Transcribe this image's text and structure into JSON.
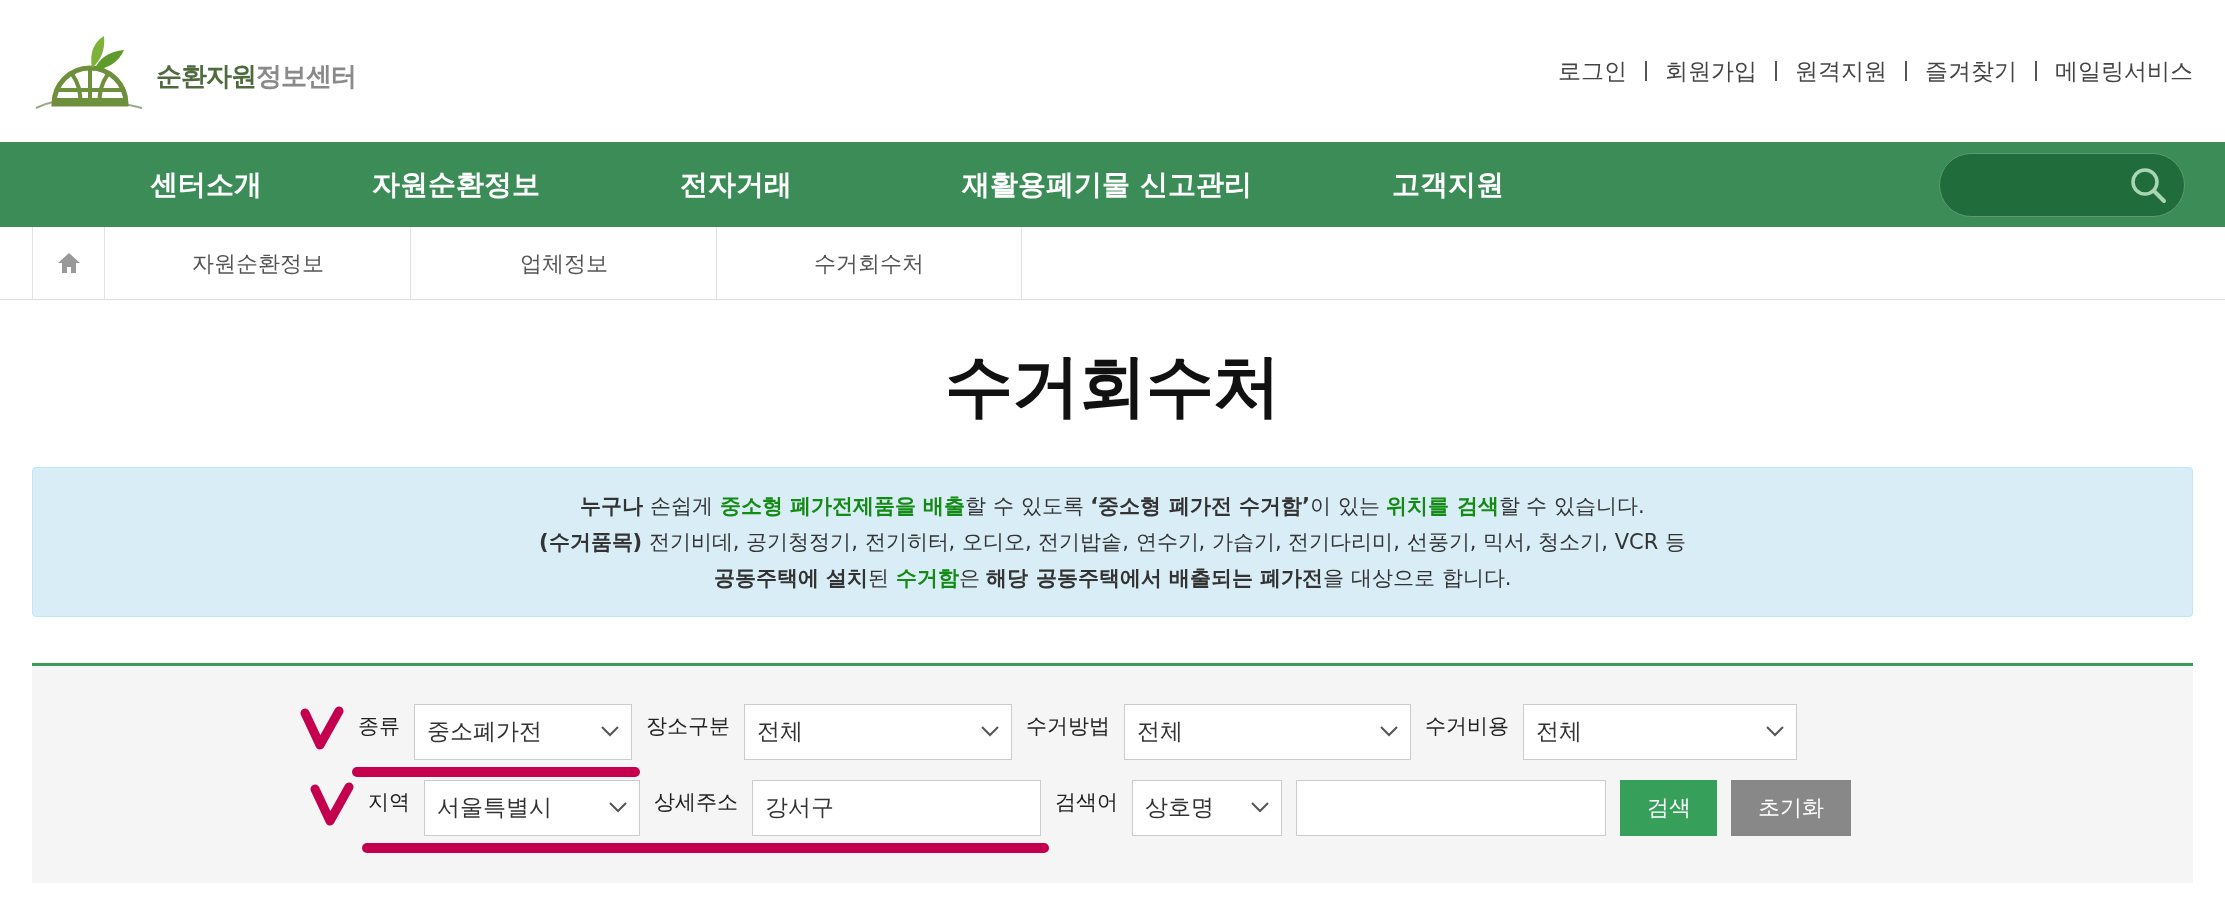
{
  "logo": {
    "text_primary": "순환자원",
    "text_secondary": "정보센터"
  },
  "top_links": [
    "로그인",
    "회원가입",
    "원격지원",
    "즐겨찾기",
    "메일링서비스"
  ],
  "main_nav": [
    "센터소개",
    "자원순환정보",
    "전자거래",
    "재활용폐기물 신고관리",
    "고객지원"
  ],
  "breadcrumb": [
    "자원순환정보",
    "업체정보",
    "수거회수처"
  ],
  "page_title": "수거회수처",
  "notice": {
    "lines": [
      [
        {
          "text": "누구나",
          "kind": "emphasis"
        },
        {
          "text": " 손쉽게 ",
          "kind": "normal"
        },
        {
          "text": "중소형 폐가전제품을 배출",
          "kind": "highlight"
        },
        {
          "text": "할 수 있도록 ",
          "kind": "normal"
        },
        {
          "text": "‘중소형 폐가전 수거함’",
          "kind": "emphasis"
        },
        {
          "text": "이 있는 ",
          "kind": "normal"
        },
        {
          "text": "위치를 검색",
          "kind": "highlight"
        },
        {
          "text": "할 수 있습니다.",
          "kind": "normal"
        }
      ],
      [
        {
          "text": "(수거품목)",
          "kind": "emphasis"
        },
        {
          "text": " 전기비데, 공기청정기, 전기히터, 오디오, 전기밥솥, 연수기, 가습기, 전기다리미, 선풍기, 믹서, 청소기, VCR 등",
          "kind": "normal"
        }
      ],
      [
        {
          "text": "공동주택에 설치",
          "kind": "emphasis"
        },
        {
          "text": "된 ",
          "kind": "normal"
        },
        {
          "text": "수거함",
          "kind": "highlight"
        },
        {
          "text": "은 ",
          "kind": "normal"
        },
        {
          "text": "해당 공동주택에서 배출되는 폐가전",
          "kind": "emphasis"
        },
        {
          "text": "을 대상으로 합니다.",
          "kind": "normal"
        }
      ]
    ]
  },
  "search_form": {
    "rows": [
      {
        "marked": true,
        "fields": [
          {
            "kind": "select",
            "label": "종류",
            "value": "중소폐가전",
            "underlined": true
          },
          {
            "kind": "select",
            "label": "장소구분",
            "value": "전체",
            "underlined": false
          },
          {
            "kind": "select",
            "label": "수거방법",
            "value": "전체",
            "underlined": false
          },
          {
            "kind": "select",
            "label": "수거비용",
            "value": "전체",
            "underlined": false
          }
        ]
      },
      {
        "marked": true,
        "fields": [
          {
            "kind": "select",
            "label": "지역",
            "value": "서울특별시",
            "underlined": true
          },
          {
            "kind": "input",
            "label": "상세주소",
            "value": "강서구",
            "underlined": true
          },
          {
            "kind": "select",
            "label": "검색어",
            "value": "상호명",
            "underlined": false
          },
          {
            "kind": "input",
            "underlined": false
          },
          {
            "kind": "button",
            "label": "검색"
          },
          {
            "kind": "button",
            "label": "초기화"
          }
        ]
      }
    ]
  }
}
